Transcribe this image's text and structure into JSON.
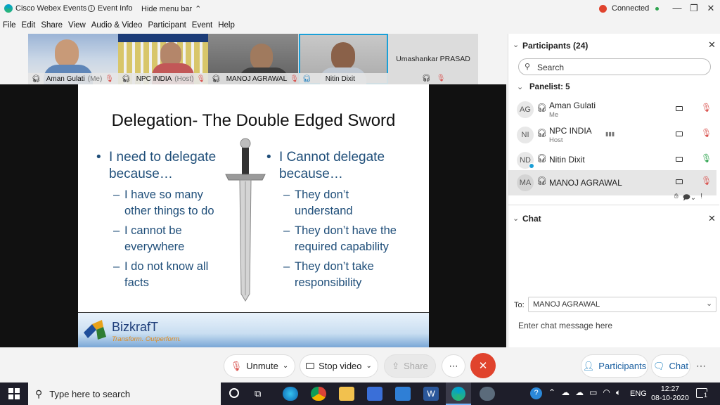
{
  "titlebar": {
    "app_name": "Cisco Webex Events",
    "event_info": "Event Info",
    "hide_menu": "Hide menu bar",
    "status": "Connected"
  },
  "menu": [
    "File",
    "Edit",
    "Share",
    "View",
    "Audio & Video",
    "Participant",
    "Event",
    "Help"
  ],
  "videos": [
    {
      "name": "Aman Gulati",
      "tag": "(Me)"
    },
    {
      "name": "NPC INDIA",
      "tag": "(Host)"
    },
    {
      "name": "MANOJ AGRAWAL",
      "tag": ""
    },
    {
      "name": "Nitin Dixit",
      "tag": ""
    },
    {
      "name": "Umashankar PRASAD",
      "tag": ""
    }
  ],
  "slide": {
    "title": "Delegation- The Double Edged Sword",
    "left_main": [
      "I need to delegate",
      "because…"
    ],
    "left_subs": [
      [
        "I have so many",
        "other things to do"
      ],
      [
        "I cannot be",
        "everywhere"
      ],
      [
        "I do not know all",
        "facts"
      ]
    ],
    "right_main": [
      "I Cannot delegate",
      "because…"
    ],
    "right_subs": [
      [
        "They don’t",
        "understand"
      ],
      [
        "They don’t have the",
        "required capability"
      ],
      [
        "They don’t take",
        "responsibility"
      ]
    ],
    "brand": "BizkrafT",
    "tagline": "Transform. Outperform."
  },
  "participants": {
    "header": "Participants (24)",
    "search_placeholder": "Search",
    "panelist_label": "Panelist: 5",
    "rows": [
      {
        "initials": "AG",
        "name": "Aman Gulati",
        "sub": "Me"
      },
      {
        "initials": "NI",
        "name": "NPC INDIA",
        "sub": "Host"
      },
      {
        "initials": "ND",
        "name": "Nitin Dixit",
        "sub": ""
      },
      {
        "initials": "MA",
        "name": "MANOJ AGRAWAL",
        "sub": ""
      }
    ]
  },
  "chat": {
    "header": "Chat",
    "to_label": "To:",
    "to_value": "MANOJ AGRAWAL",
    "placeholder": "Enter chat message here"
  },
  "controls": {
    "unmute": "Unmute",
    "stop_video": "Stop video",
    "share": "Share",
    "participants": "Participants",
    "chat": "Chat"
  },
  "taskbar": {
    "search": "Type here to search",
    "lang": "ENG",
    "time": "12:27",
    "date": "08-10-2020",
    "notif": "1"
  },
  "colors": {
    "accent": "#1f4e79",
    "end": "#e0432d",
    "connected": "#2ea44f"
  }
}
